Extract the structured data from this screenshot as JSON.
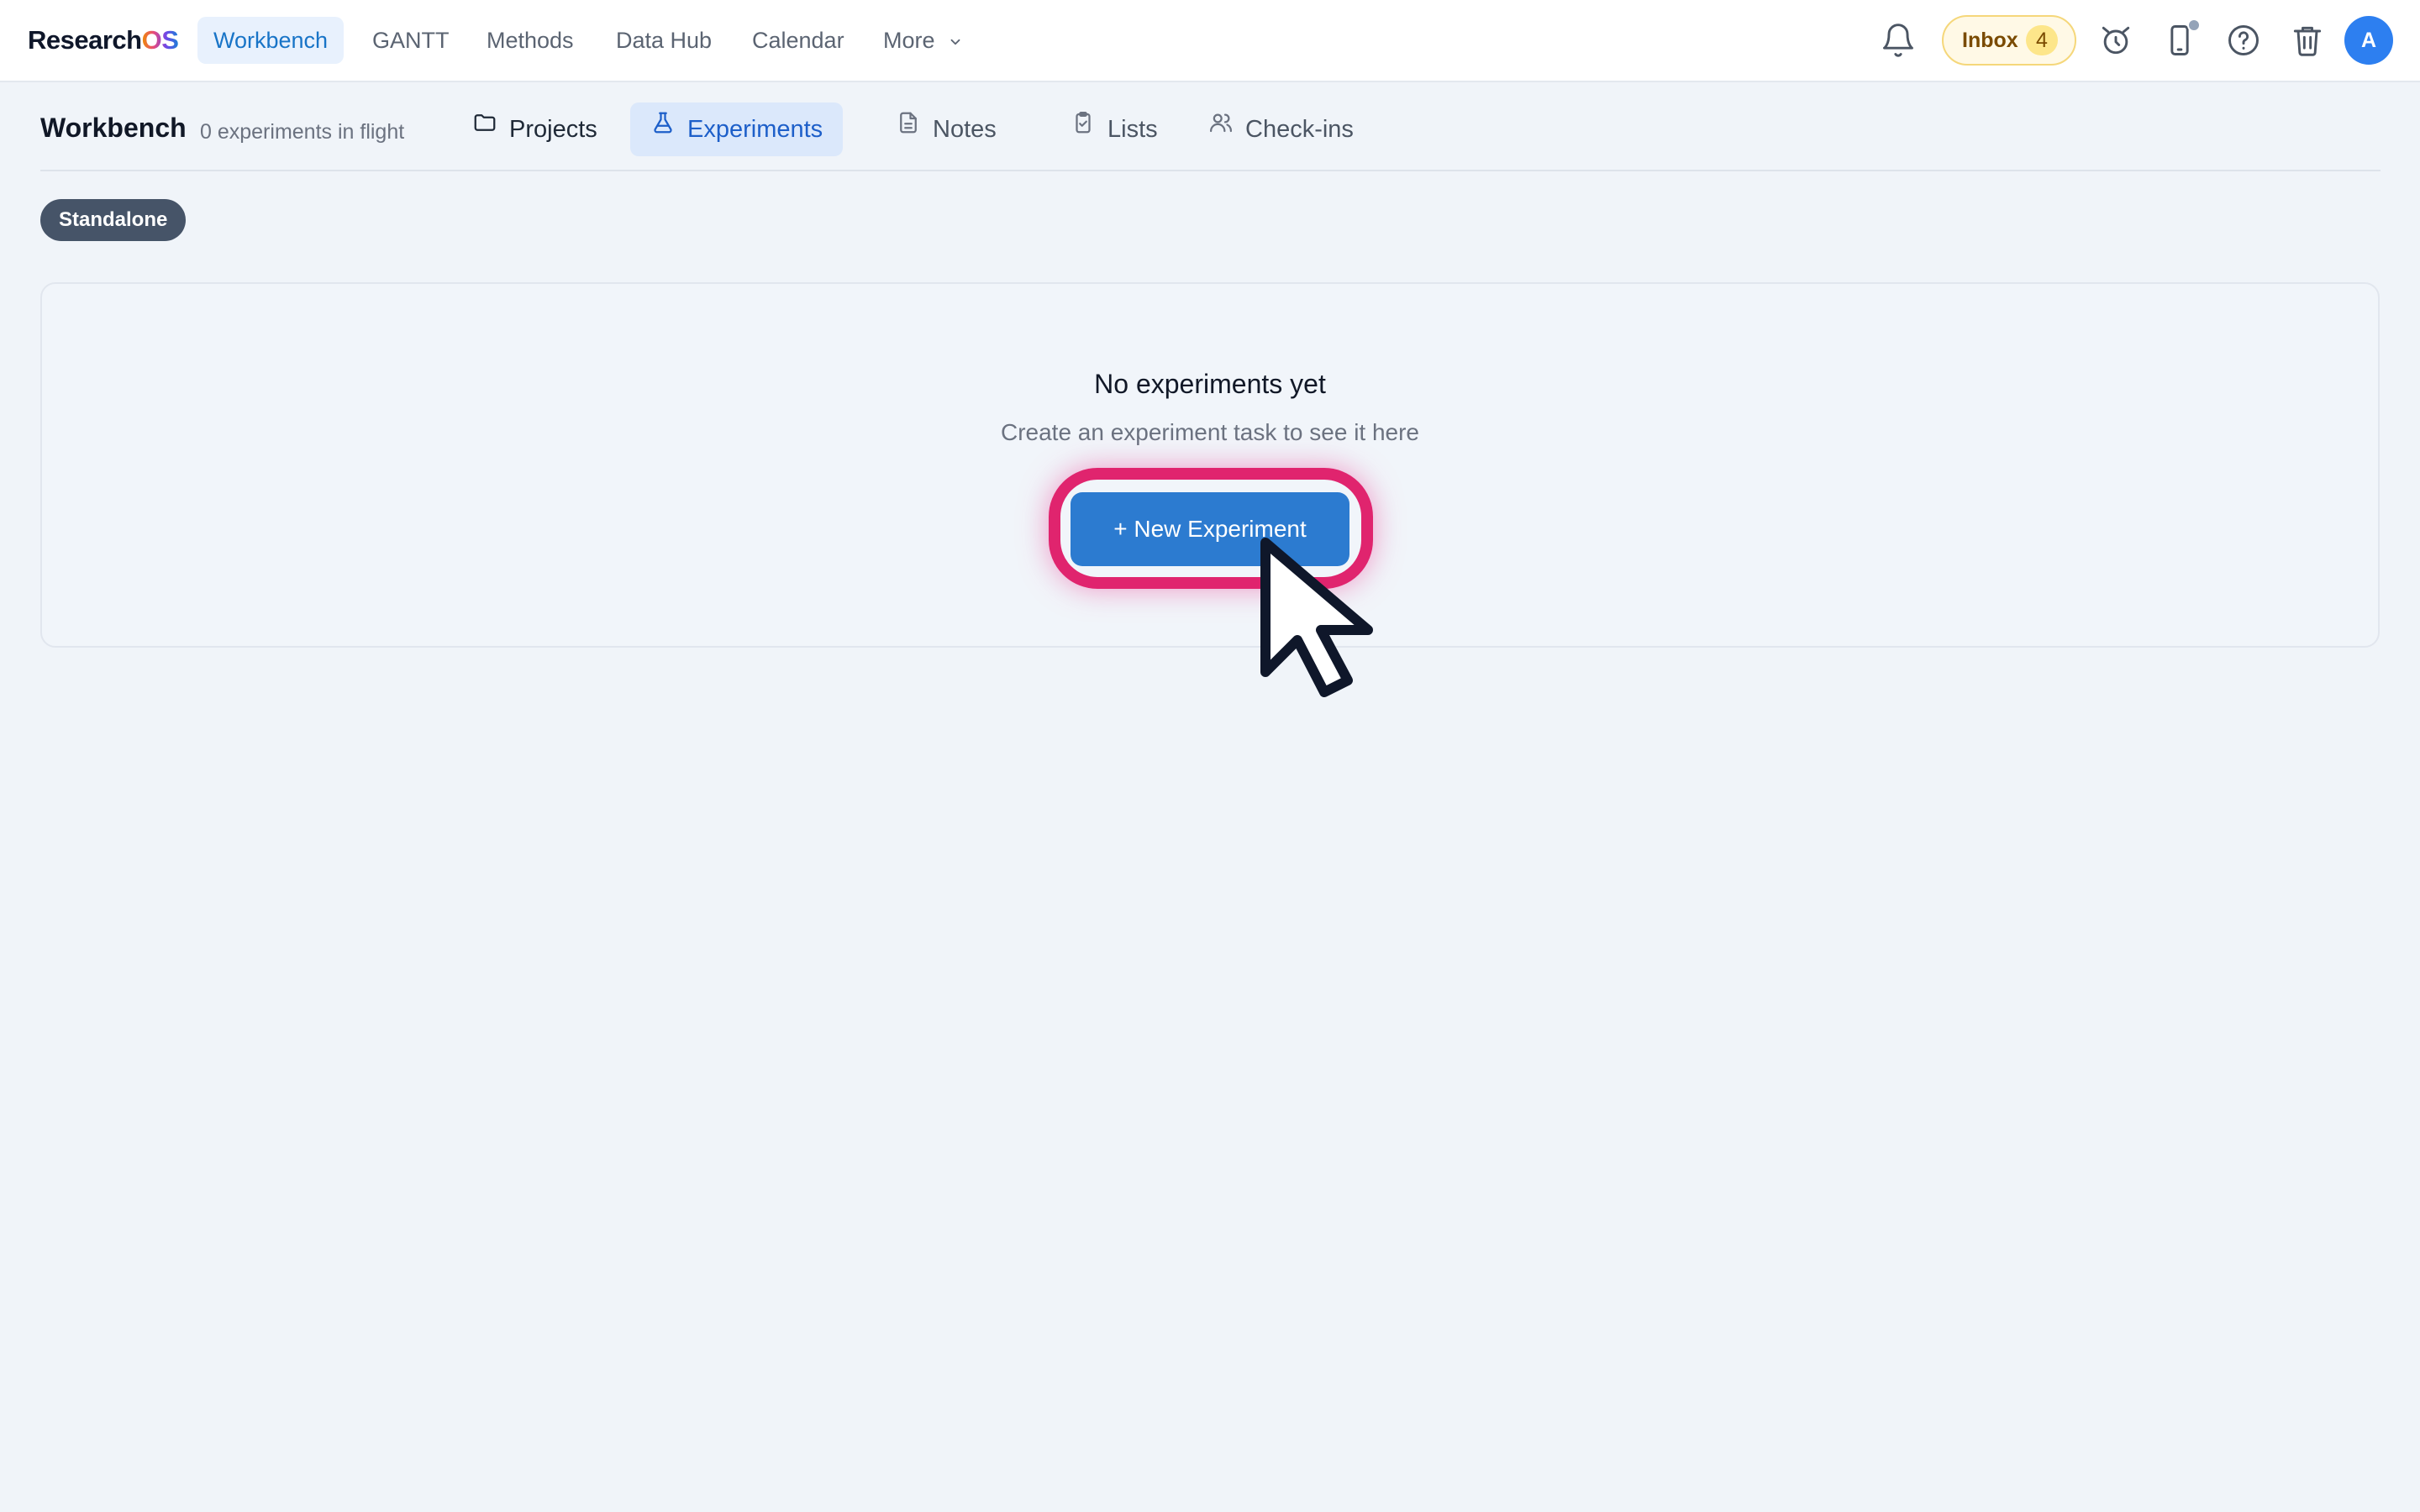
{
  "brand": {
    "name_part1": "Research",
    "name_part2": "OS"
  },
  "nav": {
    "items": [
      {
        "label": "Workbench",
        "active": true
      },
      {
        "label": "GANTT",
        "active": false
      },
      {
        "label": "Methods",
        "active": false
      },
      {
        "label": "Data Hub",
        "active": false
      },
      {
        "label": "Calendar",
        "active": false
      },
      {
        "label": "More",
        "active": false
      }
    ]
  },
  "topbar": {
    "inbox_label": "Inbox",
    "inbox_count": "4",
    "avatar_initial": "A",
    "icons": [
      "bell-icon",
      "alarm-clock-icon",
      "phone-icon",
      "help-icon",
      "trash-icon",
      "chevron-down-icon"
    ]
  },
  "page": {
    "title": "Workbench",
    "subtitle": "0 experiments in flight"
  },
  "tabs": [
    {
      "label": "Projects",
      "icon": "folder-icon",
      "active": false
    },
    {
      "label": "Experiments",
      "icon": "flask-icon",
      "active": true
    },
    {
      "label": "Notes",
      "icon": "document-icon",
      "active": false
    },
    {
      "label": "Lists",
      "icon": "clipboard-icon",
      "active": false
    },
    {
      "label": "Check-ins",
      "icon": "users-icon",
      "active": false
    }
  ],
  "filter_chip": {
    "label": "Standalone"
  },
  "empty_state": {
    "title": "No experiments yet",
    "subtitle": "Create an experiment task to see it here",
    "button_label": "+ New Experiment"
  },
  "colors": {
    "accent": "#2c7bd0",
    "active_nav_bg": "#e8f1fd",
    "highlight_ring": "#e0246e",
    "chip_bg": "#465468",
    "inbox_bg": "#fff9e6",
    "avatar_bg": "#2d7ff0"
  }
}
